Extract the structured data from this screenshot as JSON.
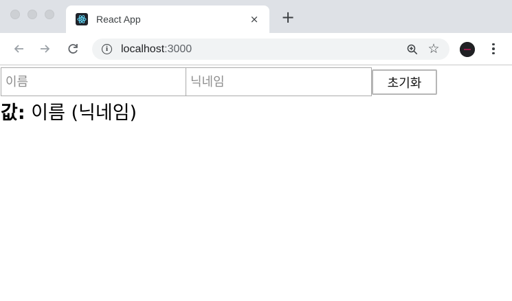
{
  "browser": {
    "tab_title": "React App",
    "tab_close": "×",
    "new_tab": "+",
    "url_host": "localhost",
    "url_port": ":3000",
    "icons": [
      "back-arrow-icon",
      "forward-arrow-icon",
      "reload-icon",
      "info-icon",
      "zoom-icon",
      "star-icon",
      "extension-icon",
      "menu-icon",
      "react-favicon-icon"
    ]
  },
  "form": {
    "name_placeholder": "이름",
    "name_value": "",
    "nickname_placeholder": "닉네임",
    "nickname_value": "",
    "reset_label": "초기화"
  },
  "output": {
    "label": "값:",
    "value": "이름 (닉네임)"
  }
}
